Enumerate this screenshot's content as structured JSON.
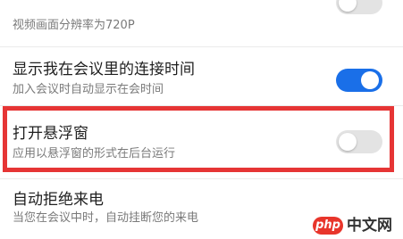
{
  "settings": [
    {
      "title": "",
      "subtitle": "视频画面分辨率为720P",
      "toggle": "off"
    },
    {
      "title": "显示我在会议里的连接时间",
      "subtitle": "加入会议时自动显示在会时间",
      "toggle": "on"
    },
    {
      "title": "打开悬浮窗",
      "subtitle": "应用以悬浮窗的形式在后台运行",
      "toggle": "off"
    },
    {
      "title": "自动拒绝来电",
      "subtitle": "当您在会议中时，自动挂断您的来电",
      "toggle": null
    }
  ],
  "colors": {
    "toggle_on": "#1a6fe8",
    "toggle_off": "#e3e3e3",
    "highlight": "#e63535"
  },
  "watermark": {
    "logo": "php",
    "text": "中文网"
  }
}
